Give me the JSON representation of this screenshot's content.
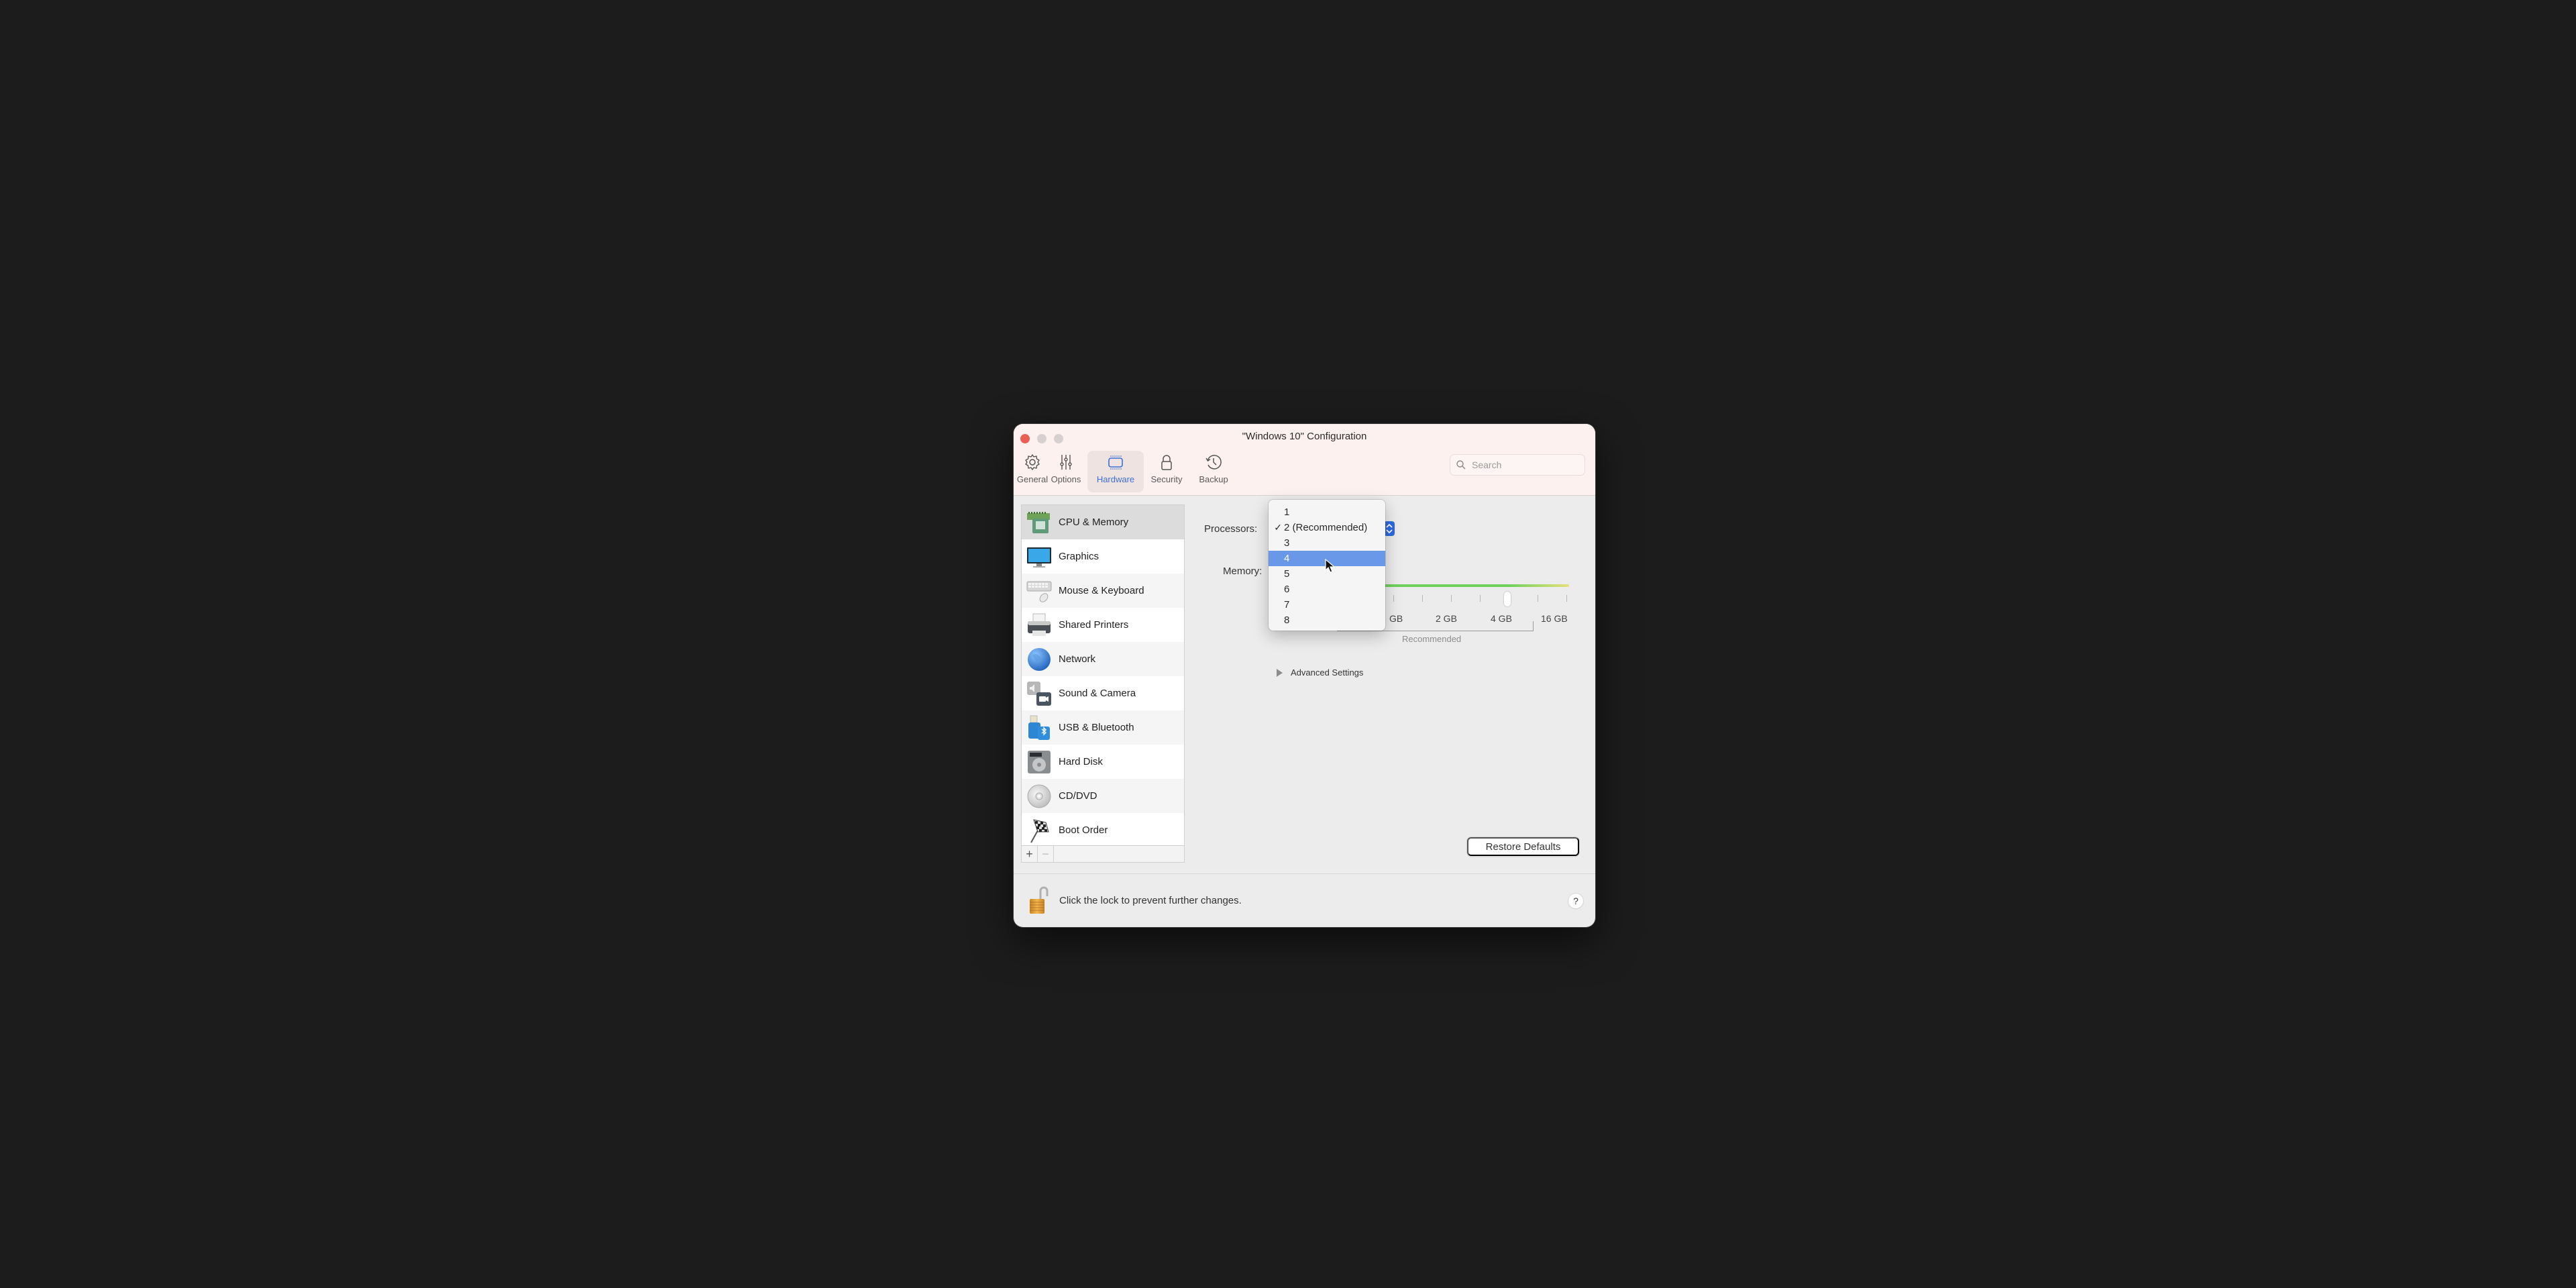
{
  "window": {
    "title": "\"Windows 10\" Configuration"
  },
  "toolbar": {
    "tabs": [
      {
        "label": "General",
        "icon": "gear-icon"
      },
      {
        "label": "Options",
        "icon": "sliders-icon"
      },
      {
        "label": "Hardware",
        "icon": "chip-icon",
        "active": true
      },
      {
        "label": "Security",
        "icon": "lock-icon"
      },
      {
        "label": "Backup",
        "icon": "history-clock-icon"
      }
    ],
    "search_placeholder": "Search"
  },
  "sidebar": {
    "items": [
      {
        "label": "CPU & Memory",
        "icon": "cpu-memory-icon",
        "selected": true
      },
      {
        "label": "Graphics",
        "icon": "monitor-icon"
      },
      {
        "label": "Mouse & Keyboard",
        "icon": "keyboard-mouse-icon"
      },
      {
        "label": "Shared Printers",
        "icon": "printer-icon"
      },
      {
        "label": "Network",
        "icon": "globe-icon"
      },
      {
        "label": "Sound & Camera",
        "icon": "speaker-camera-icon"
      },
      {
        "label": "USB & Bluetooth",
        "icon": "usb-bluetooth-icon"
      },
      {
        "label": "Hard Disk",
        "icon": "hard-disk-icon"
      },
      {
        "label": "CD/DVD",
        "icon": "cd-dvd-icon"
      },
      {
        "label": "Boot Order",
        "icon": "checkered-flag-icon"
      }
    ],
    "add_label": "+",
    "remove_label": "−"
  },
  "main": {
    "processors_label": "Processors:",
    "memory_label": "Memory:",
    "processors_popup": {
      "options": [
        {
          "label": "1",
          "checked": false
        },
        {
          "label": "2 (Recommended)",
          "checked": true
        },
        {
          "label": "3",
          "checked": false
        },
        {
          "label": "4",
          "checked": false,
          "highlighted": true
        },
        {
          "label": "5",
          "checked": false
        },
        {
          "label": "6",
          "checked": false
        },
        {
          "label": "7",
          "checked": false
        },
        {
          "label": "8",
          "checked": false
        }
      ],
      "check_mark": "✓"
    },
    "memory_slider": {
      "tick_labels": [
        "GB",
        "2 GB",
        "4 GB",
        "16 GB"
      ],
      "value_label": "4 GB",
      "recommended_label": "Recommended"
    },
    "advanced_settings_label": "Advanced Settings",
    "restore_defaults_label": "Restore Defaults"
  },
  "footer": {
    "lock_text": "Click the lock to prevent further changes.",
    "help_label": "?"
  },
  "colors": {
    "accent": "#3b6fd8",
    "highlight": "#6a98e8",
    "slider_green": "#6fd15c",
    "slider_yellow": "#e6e07a",
    "close_button": "#ec5f56"
  }
}
